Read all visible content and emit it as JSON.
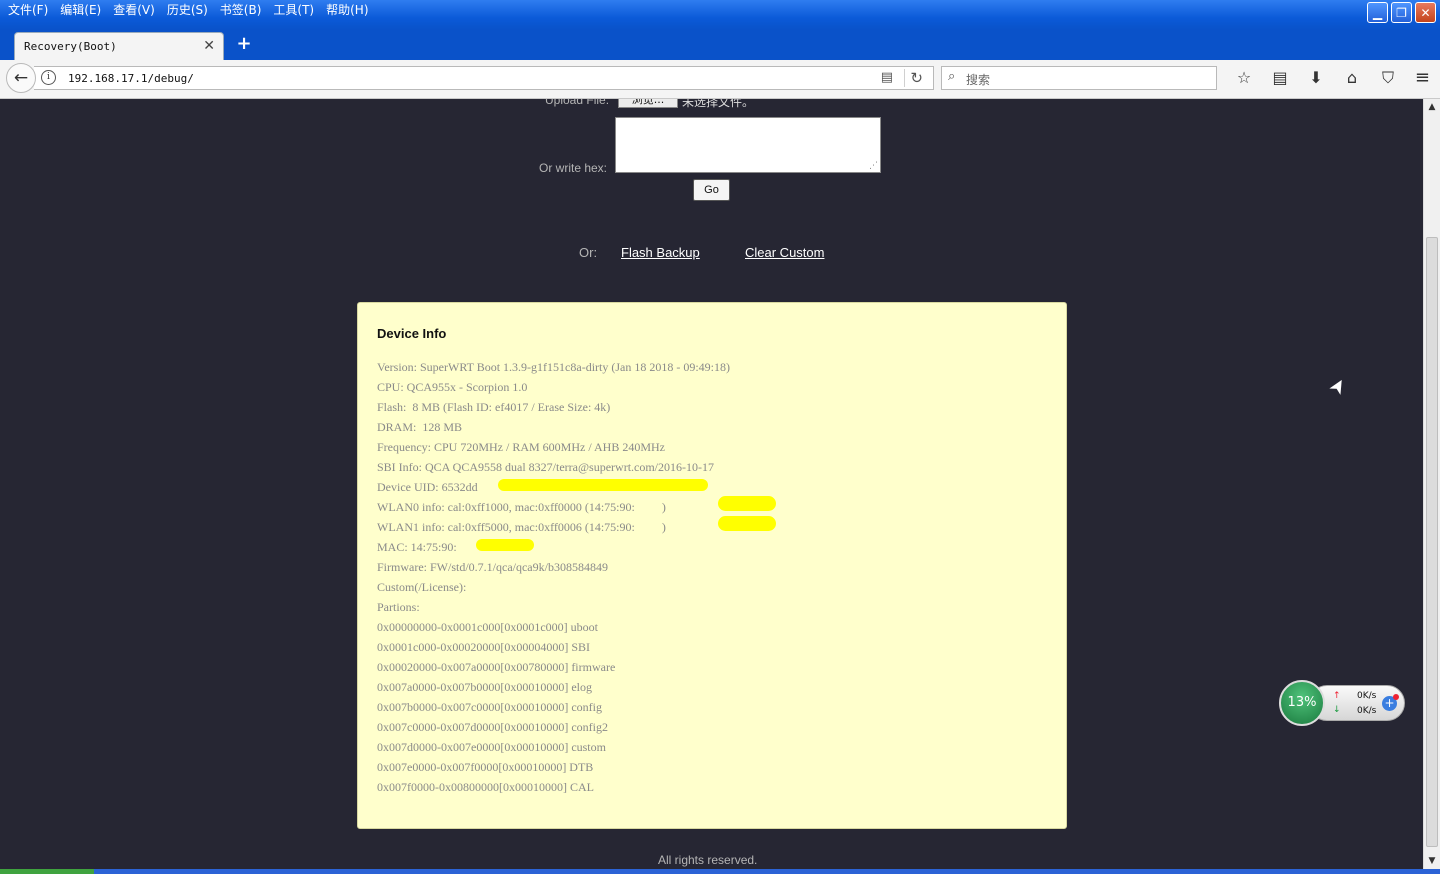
{
  "menu": [
    "文件(F)",
    "编辑(E)",
    "查看(V)",
    "历史(S)",
    "书签(B)",
    "工具(T)",
    "帮助(H)"
  ],
  "window_controls": {
    "minimize": "▁",
    "restore": "❐",
    "close": "✕"
  },
  "tab": {
    "title": "Recovery(Boot)",
    "close": "✕",
    "new_tab": "+"
  },
  "nav": {
    "back": "←",
    "info": "i",
    "url_host": "192.168.17.1/debug/",
    "reader": "▤",
    "reload": "↻",
    "search_placeholder": "搜索",
    "search_icon": "⌕",
    "icons": [
      "☆",
      "▤",
      "⬇",
      "⌂",
      "⛉"
    ],
    "menu": "≡"
  },
  "upload": {
    "label": "Upload File:",
    "browse": "浏览...",
    "no_file": "未选择文件。"
  },
  "hex": {
    "label": "Or write hex:",
    "go": "Go",
    "grip": "⋰"
  },
  "links": {
    "or": "Or:",
    "flash_backup": "Flash Backup",
    "clear_custom": "Clear Custom"
  },
  "device_info": {
    "title": "Device Info",
    "lines": [
      "Version: SuperWRT Boot 1.3.9-g1f151c8a-dirty (Jan 18 2018 - 09:49:18)",
      "CPU: QCA955x - Scorpion 1.0",
      "Flash:  8 MB (Flash ID: ef4017 / Erase Size: 4k)",
      "DRAM:  128 MB",
      "Frequency: CPU 720MHz / RAM 600MHz / AHB 240MHz",
      "SBI Info: QCA QCA9558 dual 8327/terra@superwrt.com/2016-10-17",
      "Device UID: 6532dd",
      "WLAN0 info: cal:0xff1000, mac:0xff0000 (14:75:90:         )",
      "WLAN1 info: cal:0xff5000, mac:0xff0006 (14:75:90:         )",
      "MAC: 14:75:90:",
      "Firmware: FW/std/0.7.1/qca/qca9k/b308584849",
      "Custom(/License):",
      "Partions:",
      "0x00000000-0x0001c000[0x0001c000] uboot",
      "0x0001c000-0x00020000[0x00004000] SBI",
      "0x00020000-0x007a0000[0x00780000] firmware",
      "0x007a0000-0x007b0000[0x00010000] elog",
      "0x007b0000-0x007c0000[0x00010000] config",
      "0x007c0000-0x007d0000[0x00010000] config2",
      "0x007d0000-0x007e0000[0x00010000] custom",
      "0x007e0000-0x007f0000[0x00010000] DTB",
      "0x007f0000-0x00800000[0x00010000] CAL"
    ]
  },
  "footer": "All rights reserved.",
  "net_widget": {
    "percent": "13%",
    "up_speed": "0K/s",
    "down_speed": "0K/s",
    "up_arrow": "↑",
    "down_arrow": "↓",
    "plus": "+"
  },
  "scroll": {
    "up": "▲",
    "down": "▼"
  },
  "cursor": "➤"
}
